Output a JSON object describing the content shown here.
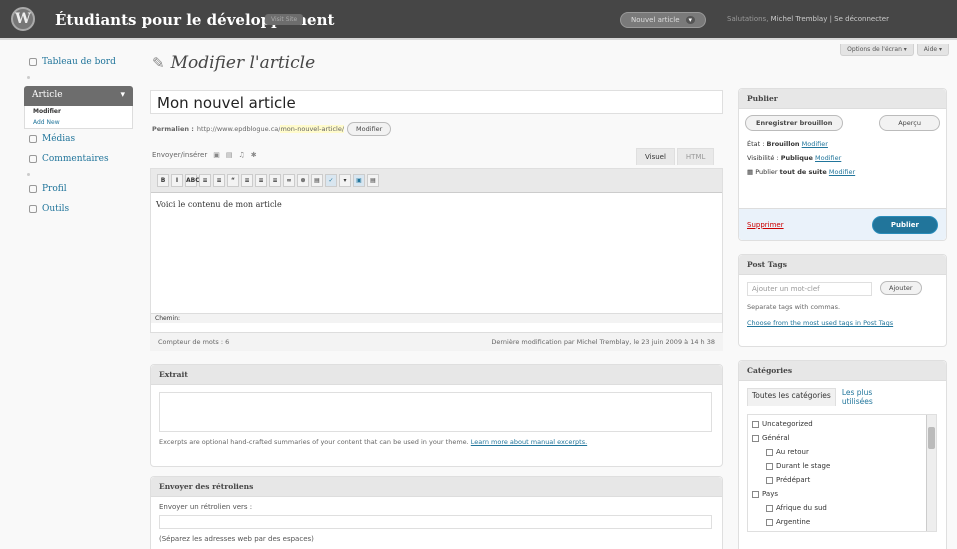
{
  "header": {
    "site_title": "Étudiants pour le développement",
    "visit_site": "Visit Site",
    "new_article": "Nouvel article",
    "howdy_prefix": "Salutations,",
    "user": "Michel Tremblay",
    "logout": "| Se déconnecter"
  },
  "screen_tabs": {
    "options": "Options de l'écran ▾",
    "help": "Aide ▾"
  },
  "sidebar": {
    "dashboard": "Tableau de bord",
    "articles": "Article",
    "submenu": [
      "Modifier",
      "Add New"
    ],
    "media": "Médias",
    "comments": "Commentaires",
    "profile": "Profil",
    "tools": "Outils"
  },
  "page_title": "Modifier l'article",
  "post": {
    "title": "Mon nouvel article",
    "permalink_label": "Permalien :",
    "permalink_base": "http://www.epdblogue.ca/",
    "permalink_slug": "mon-nouvel-article/",
    "permalink_button": "Modifier",
    "content": "Voici le contenu de mon article",
    "path_label": "Chemin:",
    "word_count": "Compteur de mots : 6",
    "last_modified": "Dernière modification par Michel Tremblay, le 23 juin 2009 à 14 h 38"
  },
  "editor": {
    "upload_label": "Envoyer/insérer",
    "tab_visual": "Visuel",
    "tab_html": "HTML",
    "toolbar": [
      "B",
      "I",
      "ABC",
      "≡",
      "≡",
      "“",
      "≡",
      "≡",
      "≡",
      "∞",
      "⊗",
      "▤",
      "✓",
      "▾",
      "▣",
      "▤"
    ]
  },
  "excerpt": {
    "title": "Extrait",
    "help": "Excerpts are optional hand-crafted summaries of your content that can be used in your theme.",
    "help_link": "Learn more about manual excerpts."
  },
  "trackbacks": {
    "title": "Envoyer des rétroliens",
    "label": "Envoyer un rétrolien vers :",
    "help": "(Séparez les adresses web par des espaces)"
  },
  "publish": {
    "title": "Publier",
    "save_draft": "Enregistrer brouillon",
    "preview": "Aperçu",
    "status_label": "État :",
    "status_value": "Brouillon",
    "visibility_label": "Visibilité :",
    "visibility_value": "Publique",
    "publish_label": "Publier",
    "publish_when": "tout de suite",
    "edit": "Modifier",
    "delete": "Supprimer",
    "publish_button": "Publier"
  },
  "post_tags": {
    "title": "Post Tags",
    "placeholder": "Ajouter un mot-clef",
    "add_button": "Ajouter",
    "help": "Separate tags with commas.",
    "choose_link": "Choose from the most used tags in Post Tags"
  },
  "categories": {
    "title": "Catégories",
    "tab_all": "Toutes les catégories",
    "tab_popular": "Les plus utilisées",
    "items": [
      {
        "label": "Uncategorized",
        "level": 0
      },
      {
        "label": "Général",
        "level": 0
      },
      {
        "label": "Au retour",
        "level": 1
      },
      {
        "label": "Durant le stage",
        "level": 1
      },
      {
        "label": "Prédépart",
        "level": 1
      },
      {
        "label": "Pays",
        "level": 0
      },
      {
        "label": "Afrique du sud",
        "level": 1
      },
      {
        "label": "Argentine",
        "level": 1
      }
    ]
  }
}
